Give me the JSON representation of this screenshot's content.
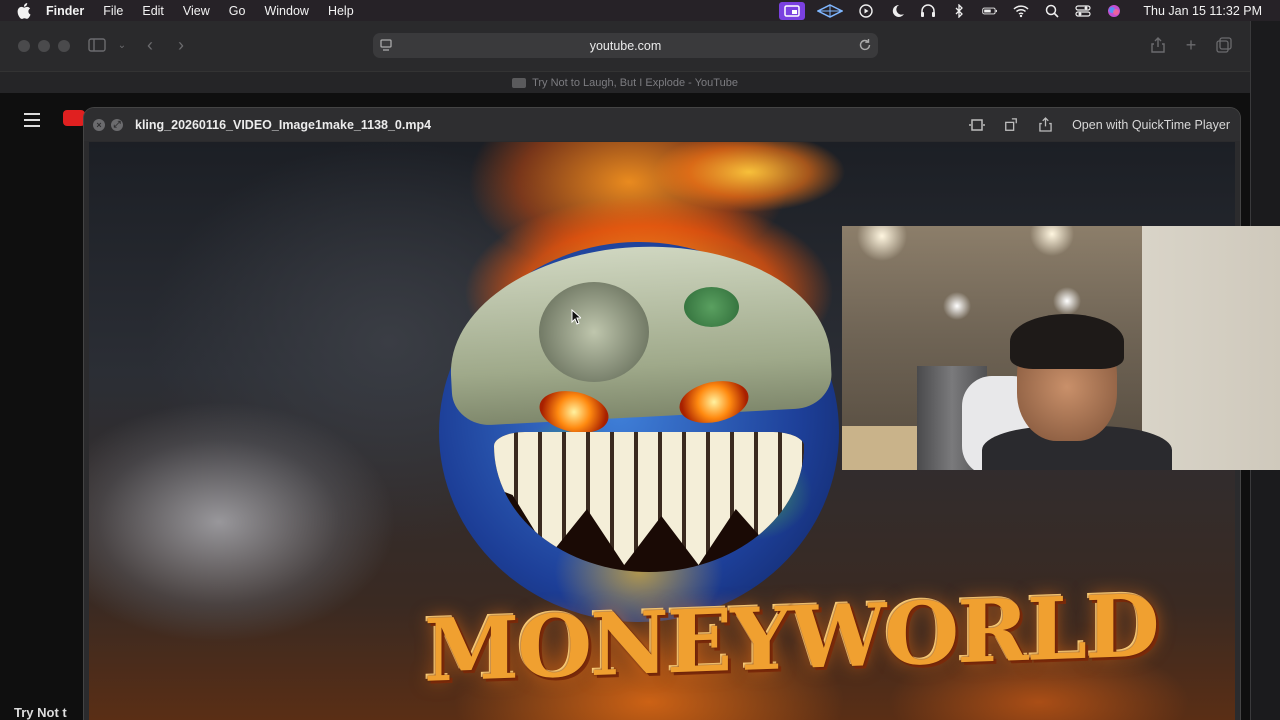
{
  "menubar": {
    "app": "Finder",
    "items": [
      "File",
      "Edit",
      "View",
      "Go",
      "Window",
      "Help"
    ],
    "clock": "Thu Jan 15  11:32 PM",
    "status_icons": [
      "screen-share-icon",
      "vpn-icon",
      "play-icon",
      "moon-icon",
      "headphones-icon",
      "bluetooth-icon",
      "battery-icon",
      "wifi-icon",
      "search-icon",
      "control-center-icon",
      "siri-icon"
    ]
  },
  "safari": {
    "address": "youtube.com",
    "tab_title": "Try Not to Laugh, But I Explode - YouTube",
    "bottom_text": "Try Not t"
  },
  "quicklook": {
    "file_name": "kling_20260116_VIDEO_Image1make_1138_0.mp4",
    "open_with": "Open with QuickTime Player"
  },
  "video": {
    "title_line": "MONEYWORLD"
  },
  "colors": {
    "menubar_bg": "#262227",
    "accent_purple": "#7a40e0",
    "youtube_red": "#e02020",
    "logo_orange": "#f0a030"
  }
}
